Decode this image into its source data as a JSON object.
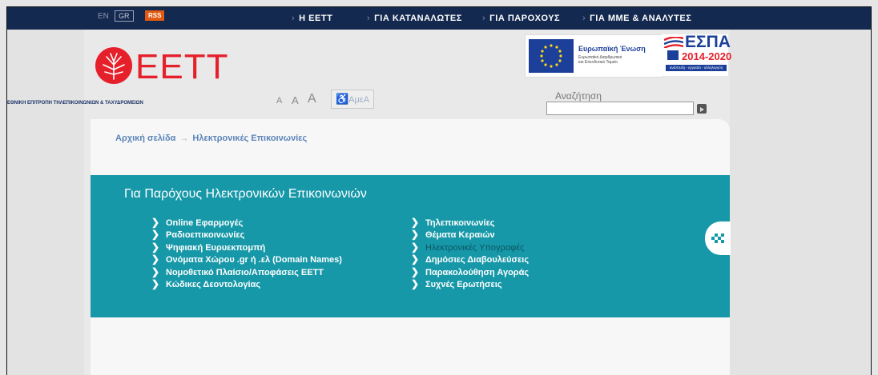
{
  "topbar": {
    "lang_en": "EN",
    "lang_gr": "GR",
    "rss": "RSS",
    "nav": [
      "Η ΕΕΤΤ",
      "ΓΙΑ ΚΑΤΑΝΑΛΩΤΕΣ",
      "ΓΙΑ ΠΑΡΟΧΟΥΣ",
      "ΓΙΑ ΜΜΕ & ΑΝΑΛΥΤΕΣ"
    ]
  },
  "header": {
    "logo_text": "ΕΕΤΤ",
    "logo_sub": "ΕΘΝΙΚΗ ΕΠΙΤΡΟΠΗ ΤΗΛΕΠΙΚΟΙΝΩΝΙΩΝ & ΤΑΧΥΔΡΟΜΕΙΩΝ",
    "font_sizes": [
      "A",
      "A",
      "A"
    ],
    "amea": "ΑμεΑ",
    "eu_title": "Ευρωπαϊκή Ένωση",
    "eu_sub1": "Ευρωπαϊκό Διαρθρωτικό",
    "eu_sub2": "και Επενδυτικό Ταμείο",
    "espa_title": "ΕΣΠΑ",
    "espa_years": "2014-2020",
    "espa_tagline": "ανάπτυξη - εργασία - αλληλεγγύη",
    "search_label": "Αναζήτηση",
    "search_value": ""
  },
  "breadcrumb": {
    "home": "Αρχική σελίδα",
    "sep": "→",
    "current": "Ηλεκτρονικές Επικοινωνίες"
  },
  "main": {
    "title": "Για Παρόχους Ηλεκτρονικών Επικοινωνιών",
    "chevron": "❯",
    "col1": [
      "Online Εφαρμογές",
      "Ραδιοεπικοινωνίες",
      "Ψηφιακή Ευρυεκπομπή",
      "Ονόματα Χώρου .gr ή .ελ (Domain Names)",
      "Νομοθετικό Πλαίσιο/Αποφάσεις ΕΕΤΤ",
      "Κώδικες Δεοντολογίας"
    ],
    "col2": [
      "Τηλεπικοινωνίες",
      "Θέματα Κεραιών",
      "Ηλεκτρονικές Υπογραφές",
      "Δημόσιες Διαβουλεύσεις",
      "Παρακολούθηση Αγοράς",
      "Συχνές Ερωτήσεις"
    ]
  },
  "colors": {
    "topbar": "#14294f",
    "teal": "#1798a8",
    "brand_red": "#e5202b",
    "link": "#5b84b8"
  }
}
